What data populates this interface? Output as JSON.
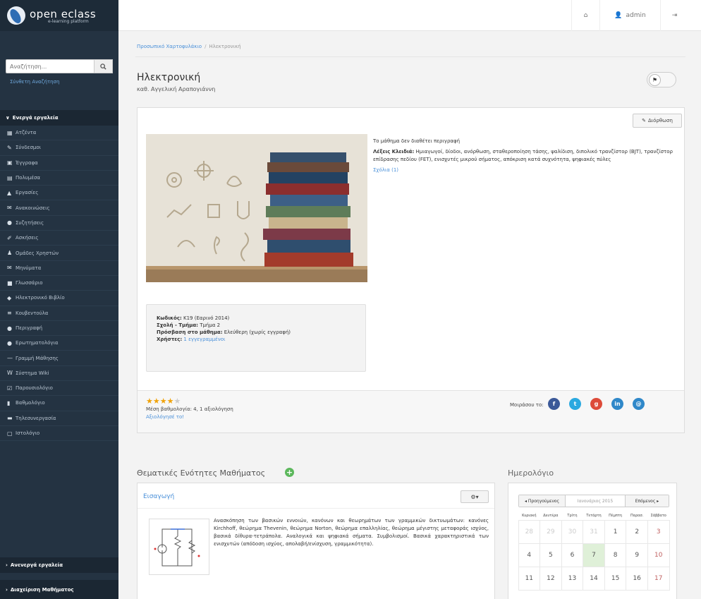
{
  "brand": {
    "title": "open eclass",
    "subtitle": "e-learning platform"
  },
  "topbar": {
    "home_icon": "home-icon",
    "user_label": "admin",
    "logout_icon": "logout-icon"
  },
  "sidebar": {
    "search_placeholder": "Αναζήτηση...",
    "advanced_search": "Σύνθετη Αναζήτηση",
    "active_tools_label": "Ενεργά εργαλεία",
    "inactive_tools_label": "Ανενεργά εργαλεία",
    "course_admin_label": "Διαχείριση Μαθήματος",
    "items": [
      {
        "label": "Ατζέντα",
        "icon": "calendar-icon"
      },
      {
        "label": "Σύνδεσμοι",
        "icon": "link-icon"
      },
      {
        "label": "Έγγραφα",
        "icon": "folder-icon"
      },
      {
        "label": "Πολυμέσα",
        "icon": "film-icon"
      },
      {
        "label": "Εργασίες",
        "icon": "flask-icon"
      },
      {
        "label": "Ανακοινώσεις",
        "icon": "bullhorn-icon"
      },
      {
        "label": "Συζητήσεις",
        "icon": "comments-icon"
      },
      {
        "label": "Ασκήσεις",
        "icon": "edit-icon"
      },
      {
        "label": "Ομάδες Χρηστών",
        "icon": "users-icon"
      },
      {
        "label": "Μηνύματα",
        "icon": "envelope-icon"
      },
      {
        "label": "Γλωσσάριο",
        "icon": "list-icon"
      },
      {
        "label": "Ηλεκτρονικό Βιβλίο",
        "icon": "book-icon"
      },
      {
        "label": "Κουβεντούλα",
        "icon": "chat-icon"
      },
      {
        "label": "Περιγραφή",
        "icon": "info-icon"
      },
      {
        "label": "Ερωτηματολόγια",
        "icon": "question-icon"
      },
      {
        "label": "Γραμμή Μάθησης",
        "icon": "line-icon"
      },
      {
        "label": "Σύστημα Wiki",
        "icon": "wiki-icon"
      },
      {
        "label": "Παρουσιολόγιο",
        "icon": "check-icon"
      },
      {
        "label": "Βαθμολόγιο",
        "icon": "grade-icon"
      },
      {
        "label": "Τηλεσυνεργασία",
        "icon": "video-icon"
      },
      {
        "label": "Ιστολόγιο",
        "icon": "blog-icon"
      }
    ]
  },
  "breadcrumb": {
    "parent": "Προσωπικό Χαρτοφυλάκιο",
    "current": "Ηλεκτρονική"
  },
  "course": {
    "title": "Ηλεκτρονική",
    "professor": "καθ. Αγγελική Αραπογιάννη",
    "edit_label": "Διόρθωση",
    "no_description": "Το μάθημα δεν διαθέτει περιγραφή",
    "keywords_label": "Λέξεις Κλειδιά:",
    "keywords": "Ημιαγωγοί, δίοδοι, ανόρθωση, σταθεροποίηση τάσης, ψαλίδιση, διπολικό τρανζίστορ (BJT), τρανζίστορ επίδρασης πεδίου (FET), ενισχυτές μικρού σήματος, απόκριση κατά συχνότητα, ψηφιακές πύλες",
    "comments_link": "Σχόλια (1)",
    "code_label": "Κωδικός:",
    "code_value": "Κ19 (Εαρινό 2014)",
    "school_label": "Σχολή - Τμήμα:",
    "school_value": "Τμήμα 2",
    "access_label": "Πρόσβαση στο μάθημα:",
    "access_value": "Ελεύθερη",
    "access_note": "(χωρίς εγγραφή)",
    "users_label": "Χρήστες:",
    "users_link": "1 εγγεγραμμένοι",
    "rating_stars": 4,
    "rating_max": 5,
    "rating_text": "Μέση βαθμολογία: 4, 1 αξιολόγηση",
    "rate_link": "Αξιολόγησέ το!",
    "share_label": "Μοιράσου το:",
    "share": [
      {
        "name": "facebook-icon",
        "glyph": "f",
        "color": "#3b5998"
      },
      {
        "name": "twitter-icon",
        "glyph": "t",
        "color": "#2aa9e0"
      },
      {
        "name": "googleplus-icon",
        "glyph": "g",
        "color": "#dd4b39"
      },
      {
        "name": "linkedin-icon",
        "glyph": "in",
        "color": "#2f88c9"
      },
      {
        "name": "email-icon",
        "glyph": "@",
        "color": "#2f88c9"
      }
    ]
  },
  "units": {
    "heading": "Θεματικές Ενότητες Μαθήματος",
    "btn_label": "⚙▾",
    "unit_title": "Εισαγωγή",
    "unit_desc": "Ανασκόπηση των βασικών εννοιών, κανόνων και θεωρημάτων των γραμμικών δικτυωμάτων: κανόνες Kirchhoff, θεώρημα Thevenin, θεώρημα Norton, θεώρημα επαλληλίας, θεώρημα μέγιστης μεταφοράς ισχύος, βασικά δίθυρα-τετράπολα. Αναλογικά και ψηφιακά σήματα. Συμβολισμοί. Βασικά χαρακτηριστικά των ενισχυτών (απόδοση ισχύος, απολαβή/ενίσχυση, γραμμικότητα)."
  },
  "calendar": {
    "heading": "Ημερολόγιο",
    "prev": "◂ Προηγούμενος",
    "month": "Ιανουάριος 2015",
    "next": "Επόμενος ▸",
    "dow": [
      "Κυριακή",
      "Δευτέρα",
      "Τρίτη",
      "Τετάρτη",
      "Πέμπτη",
      "Παρασ.",
      "Σάββατο"
    ],
    "weeks": [
      [
        "28",
        "29",
        "30",
        "31",
        "1",
        "2",
        "3"
      ],
      [
        "4",
        "5",
        "6",
        "7",
        "8",
        "9",
        "10"
      ],
      [
        "11",
        "12",
        "13",
        "14",
        "15",
        "16",
        "17"
      ]
    ],
    "today": "7"
  }
}
